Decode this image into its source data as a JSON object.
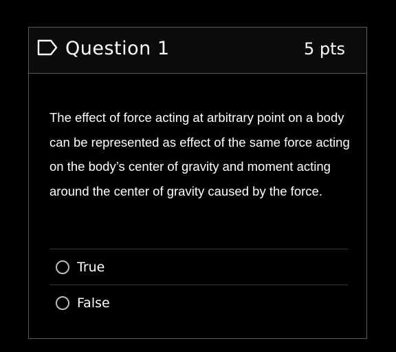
{
  "question": {
    "title": "Question 1",
    "points": "5 pts",
    "text": "The effect of force acting at arbitrary point on a body can be represented as effect of the same force acting on the body’s center of gravity and moment acting around the center of gravity caused by the force.",
    "flag_icon": "flag-outline-icon"
  },
  "answers": [
    {
      "label": "True",
      "selected": false
    },
    {
      "label": "False",
      "selected": false
    }
  ],
  "colors": {
    "background": "#000000",
    "border": "#5a5a5a",
    "text": "#ffffff",
    "radio": "#bdbdbd"
  }
}
